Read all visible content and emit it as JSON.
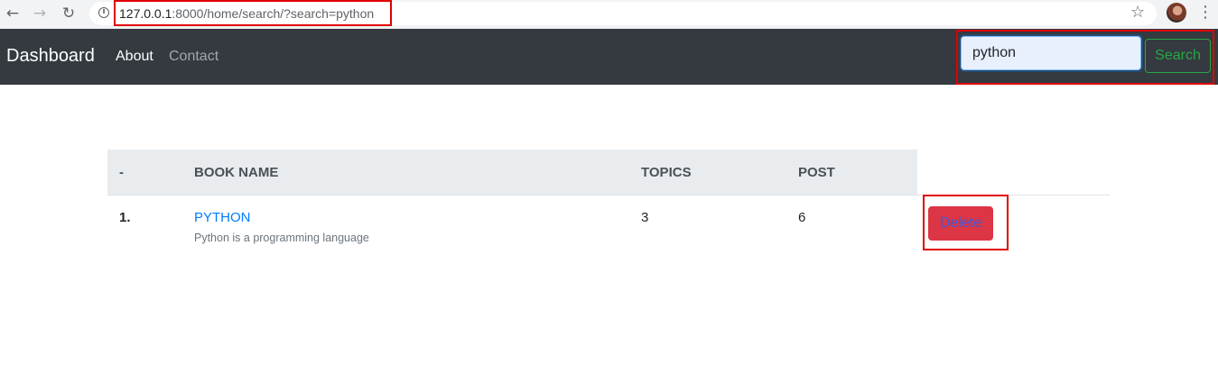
{
  "browser": {
    "url_host": "127.0.0.1",
    "url_rest": ":8000/home/search/?search=python",
    "info_icon": "i"
  },
  "navbar": {
    "brand": "Dashboard",
    "links": [
      {
        "label": "About",
        "active": true
      },
      {
        "label": "Contact",
        "active": false
      }
    ],
    "search": {
      "value": "python",
      "button_label": "Search"
    }
  },
  "table": {
    "headers": [
      "-",
      "BOOK NAME",
      "TOPICS",
      "POST"
    ],
    "rows": [
      {
        "index": "1.",
        "book_name": "PYTHON",
        "description": "Python is a programming language",
        "topics": "3",
        "post": "6",
        "action_label": "Delete"
      }
    ]
  },
  "colors": {
    "navbar_bg": "#343a40",
    "link": "#007bff",
    "success": "#28a745",
    "danger": "#dc3545",
    "annotation": "#e00000"
  }
}
